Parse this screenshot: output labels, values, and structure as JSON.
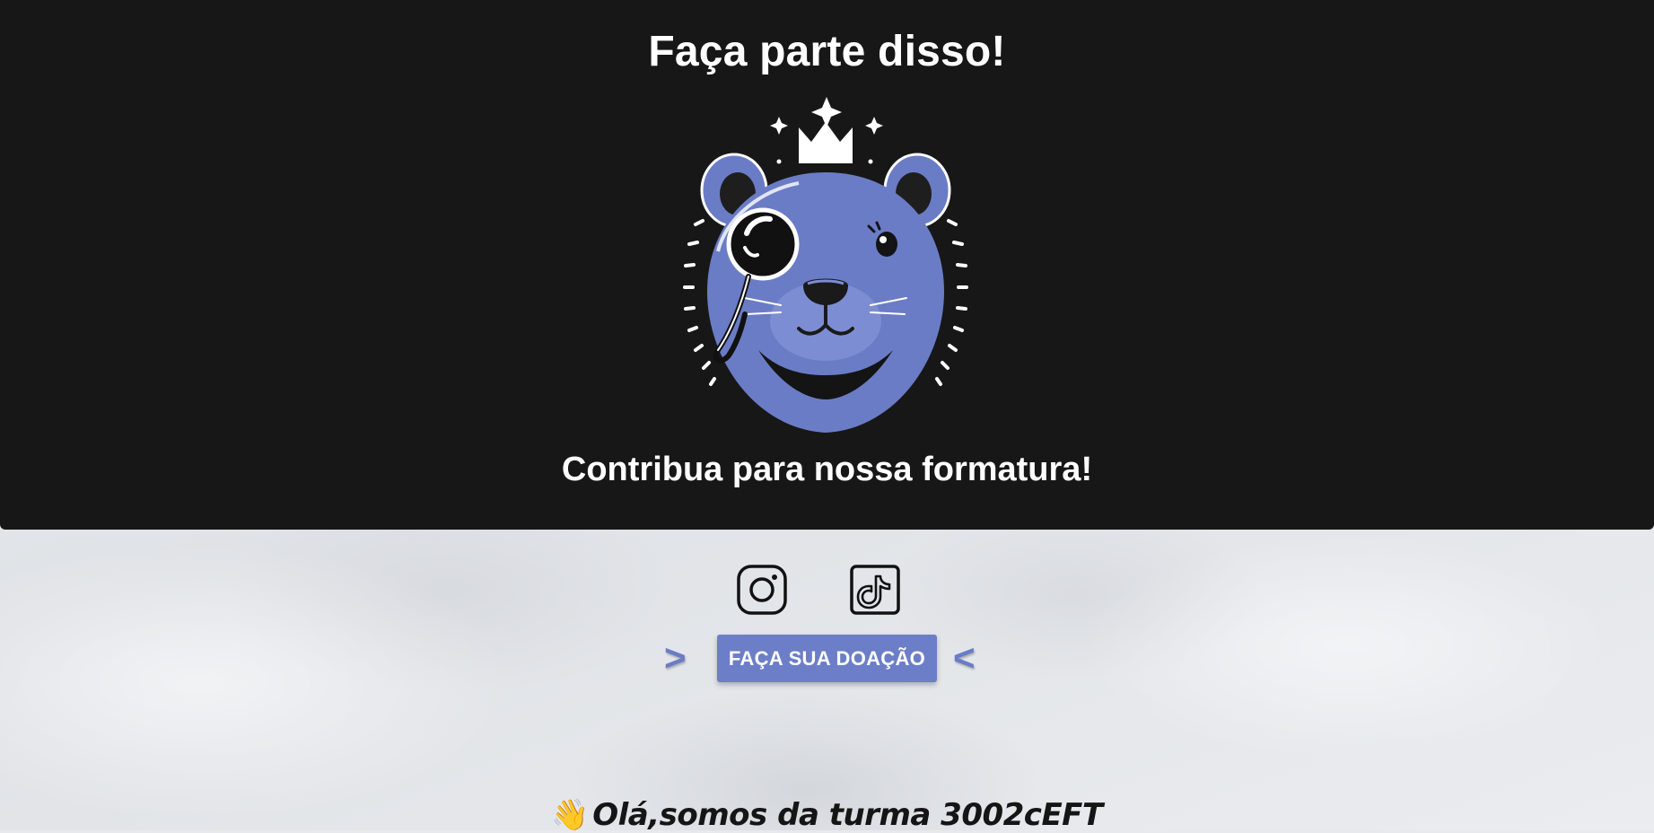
{
  "hero": {
    "title": "Faça parte disso!",
    "subtitle": "Contribua para nossa formatura!",
    "mascot_icon": "capybara-monocle-crown-logo",
    "background_color": "#171717",
    "mascot_color": "#6b7cc6"
  },
  "social": {
    "instagram_icon": "instagram-icon",
    "tiktok_icon": "tiktok-icon"
  },
  "donation": {
    "left_arrow": ">",
    "button_label": "FAÇA SUA DOAÇÃO",
    "right_arrow": "<",
    "accent_color": "#6d7ec8"
  },
  "greeting": {
    "emoji": "👋",
    "text": "Olá,somos da turma 3002cEFT"
  }
}
